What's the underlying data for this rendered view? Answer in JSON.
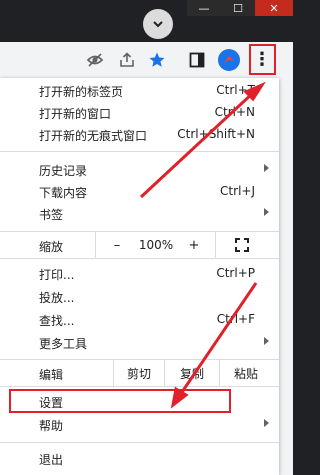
{
  "window": {
    "minimize_glyph": "—",
    "maximize_glyph": "☐",
    "close_glyph": "✕"
  },
  "toolbar": {
    "icons": [
      "eye-off-icon",
      "share-icon",
      "bookmark-star-icon",
      "side-panel-icon",
      "extension-icon",
      "more-vert-icon"
    ],
    "star_color": "#1a73e8",
    "more_glyph": "⋮"
  },
  "menu": {
    "new_tab": {
      "label": "打开新的标签页",
      "shortcut": "Ctrl+T"
    },
    "new_window": {
      "label": "打开新的窗口",
      "shortcut": "Ctrl+N"
    },
    "incognito": {
      "label": "打开新的无痕式窗口",
      "shortcut": "Ctrl+Shift+N"
    },
    "history": {
      "label": "历史记录"
    },
    "downloads": {
      "label": "下载内容",
      "shortcut": "Ctrl+J"
    },
    "bookmarks": {
      "label": "书签"
    },
    "zoom": {
      "label": "缩放",
      "minus": "–",
      "value": "100%",
      "plus": "+"
    },
    "print": {
      "label": "打印...",
      "shortcut": "Ctrl+P"
    },
    "cast": {
      "label": "投放..."
    },
    "find": {
      "label": "查找...",
      "shortcut": "Ctrl+F"
    },
    "more_tools": {
      "label": "更多工具"
    },
    "edit": {
      "label": "编辑",
      "cut": "剪切",
      "copy": "复制",
      "paste": "粘贴"
    },
    "settings": {
      "label": "设置"
    },
    "help": {
      "label": "帮助"
    },
    "exit": {
      "label": "退出"
    }
  },
  "annotation": {
    "color": "#e0202a"
  }
}
